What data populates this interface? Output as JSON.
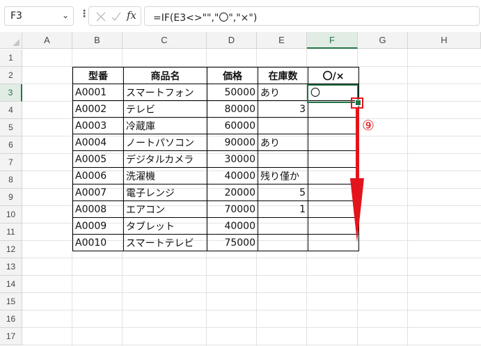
{
  "formula_bar": {
    "name_box": "F3",
    "formula": "=IF(E3<>\"\",\"〇\",\"×\")"
  },
  "columns": [
    "A",
    "B",
    "C",
    "D",
    "E",
    "F",
    "G",
    "H"
  ],
  "rows": [
    "1",
    "2",
    "3",
    "4",
    "5",
    "6",
    "7",
    "8",
    "9",
    "10",
    "11",
    "12",
    "13",
    "14",
    "15",
    "16",
    "17"
  ],
  "selected": {
    "column": "F",
    "row": "3"
  },
  "table": {
    "headers": [
      "型番",
      "商品名",
      "価格",
      "在庫数",
      "〇/×"
    ],
    "rows": [
      {
        "model": "A0001",
        "name": "スマートフォン",
        "price": "50000",
        "stock": "あり",
        "result": "〇"
      },
      {
        "model": "A0002",
        "name": "テレビ",
        "price": "80000",
        "stock": "3",
        "result": ""
      },
      {
        "model": "A0003",
        "name": "冷蔵庫",
        "price": "60000",
        "stock": "",
        "result": ""
      },
      {
        "model": "A0004",
        "name": "ノートパソコン",
        "price": "90000",
        "stock": "あり",
        "result": ""
      },
      {
        "model": "A0005",
        "name": "デジタルカメラ",
        "price": "30000",
        "stock": "",
        "result": ""
      },
      {
        "model": "A0006",
        "name": "洗濯機",
        "price": "40000",
        "stock": "残り僅か",
        "result": ""
      },
      {
        "model": "A0007",
        "name": "電子レンジ",
        "price": "20000",
        "stock": "5",
        "result": ""
      },
      {
        "model": "A0008",
        "name": "エアコン",
        "price": "70000",
        "stock": "1",
        "result": ""
      },
      {
        "model": "A0009",
        "name": "タブレット",
        "price": "40000",
        "stock": "",
        "result": ""
      },
      {
        "model": "A0010",
        "name": "スマートテレビ",
        "price": "75000",
        "stock": "",
        "result": ""
      }
    ]
  },
  "annotation": {
    "step": "⑨",
    "color": "#e3141b"
  },
  "colors": {
    "accent": "#217346",
    "annotation": "#e3141b"
  }
}
